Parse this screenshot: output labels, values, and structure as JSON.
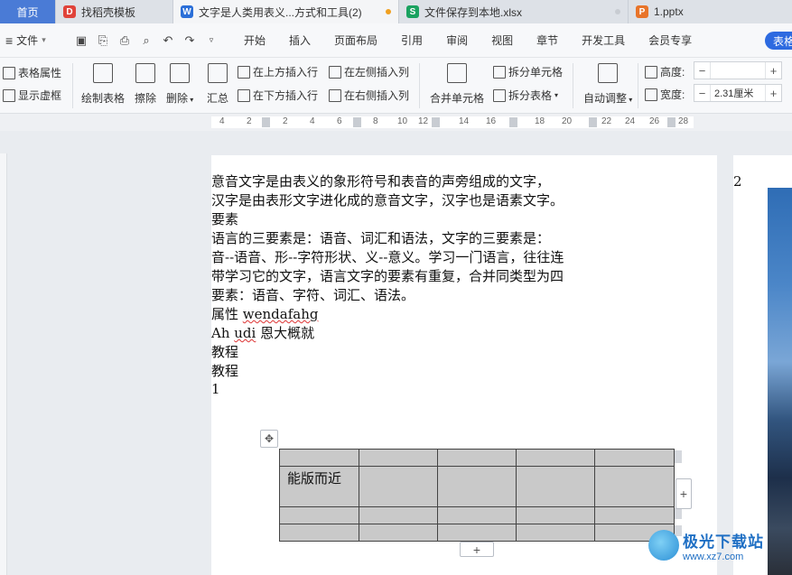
{
  "tabs": [
    {
      "label": "首页",
      "active": false
    },
    {
      "label": "找稻壳模板",
      "icon": "docer-icon",
      "color": "#e0433a"
    },
    {
      "label": "文字是人类用表义...方式和工具(2)",
      "icon": "wps-writer-icon",
      "color": "#2b6fd8",
      "active": true,
      "status_color": "#f0a020"
    },
    {
      "label": "文件保存到本地.xlsx",
      "icon": "wps-sheet-icon",
      "color": "#1aa260",
      "status_color": "#c8ccd2"
    },
    {
      "label": "1.pptx",
      "icon": "wps-slides-icon",
      "color": "#e8742a"
    }
  ],
  "menubar": {
    "file_label": "文件",
    "items": [
      "开始",
      "插入",
      "页面布局",
      "引用",
      "审阅",
      "视图",
      "章节",
      "开发工具",
      "会员专享"
    ],
    "special_label": "表格"
  },
  "ribbon": {
    "table_properties": "表格属性",
    "show_gridlines": "显示虚框",
    "draw_table": "绘制表格",
    "erase": "擦除",
    "delete": "删除",
    "summary": "汇总",
    "insert_above": "在上方插入行",
    "insert_below": "在下方插入行",
    "insert_left": "在左侧插入列",
    "insert_right": "在右侧插入列",
    "merge_cells": "合并单元格",
    "split_cells": "拆分单元格",
    "split_table": "拆分表格",
    "auto_fit": "自动调整",
    "height_label": "高度:",
    "height_value": "",
    "width_label": "宽度:",
    "width_value": "2.31厘米"
  },
  "ruler_numbers": [
    "4",
    "2",
    "2",
    "4",
    "6",
    "8",
    "10",
    "12",
    "14",
    "16",
    "18",
    "20",
    "22",
    "24",
    "26",
    "28"
  ],
  "document": {
    "lines": [
      "意音文字是由表义的象形符号和表音的声旁组成的文字，",
      "汉字是由表形文字进化成的意音文字，汉字也是语素文字。",
      "要素",
      "语言的三要素是：语音、词汇和语法，文字的三要素是：",
      "音--语音、形--字符形状、义--意义。学习一门语言，往往连",
      "带学习它的文字，语言文字的要素有重复，合并同类型为四",
      "要素：语音、字符、词汇、语法。"
    ],
    "attr_line_prefix": "属性 ",
    "attr_line_word": "wendafahg",
    "ah_prefix": "Ah ",
    "ah_word": "udi",
    "ah_suffix": " 恩大概就",
    "tutorial1": "教程",
    "tutorial2": "教程",
    "number_line": "1",
    "table_rows": [
      [
        "",
        "",
        "",
        "",
        ""
      ],
      [
        "能版而近",
        "",
        "",
        "",
        ""
      ],
      [
        "",
        "",
        "",
        "",
        ""
      ],
      [
        "",
        "",
        "",
        "",
        ""
      ]
    ],
    "page2_number": "2"
  },
  "watermark": {
    "line1": "极光下载站",
    "line2": "www.xz7.com"
  }
}
